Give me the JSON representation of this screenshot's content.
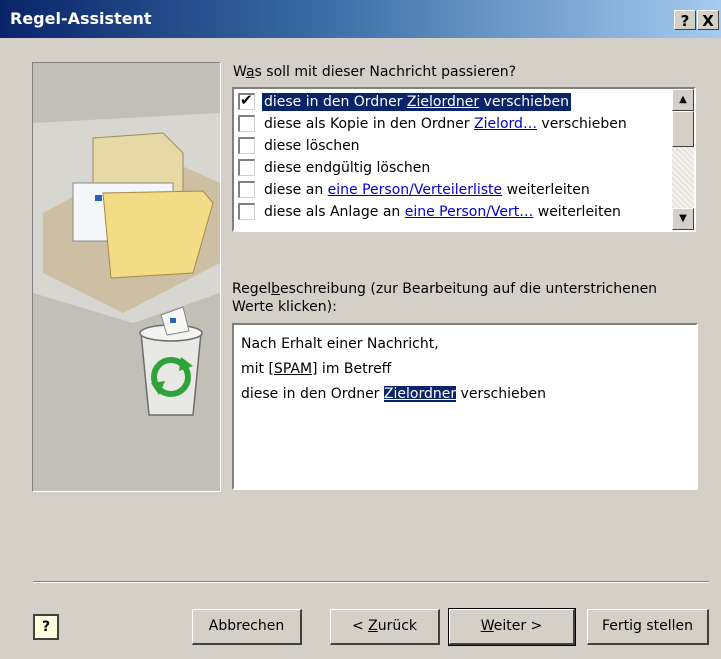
{
  "window": {
    "title": "Regel-Assistent",
    "help_btn": "?",
    "close_btn": "X"
  },
  "actions": {
    "label_prefix": "W",
    "label_u": "a",
    "label_rest": "s soll mit dieser Nachricht passieren?",
    "items": [
      {
        "checked": true,
        "pre": "diese in den Ordner ",
        "link": "Zielordner",
        "post": " verschieben"
      },
      {
        "checked": false,
        "pre": "diese als Kopie in den Ordner ",
        "link": "Zielord…",
        "post": " verschieben"
      },
      {
        "checked": false,
        "pre": "diese löschen",
        "link": "",
        "post": ""
      },
      {
        "checked": false,
        "pre": "diese endgültig löschen",
        "link": "",
        "post": ""
      },
      {
        "checked": false,
        "pre": "diese an ",
        "link": "eine Person/Verteilerliste",
        "post": " weiterleiten"
      },
      {
        "checked": false,
        "pre": "diese als Anlage an ",
        "link": "eine Person/Vert…",
        "post": " weiterleiten"
      }
    ],
    "scroll_up": "▲",
    "scroll_down": "▼"
  },
  "description": {
    "label_prefix": "Regel",
    "label_u": "b",
    "label_rest": "eschreibung (zur Bearbeitung auf die unterstrichenen",
    "label_line2": "Werte klicken):",
    "line1": "Nach Erhalt einer Nachricht,",
    "line2_pre": "mit ",
    "line2_link": "[SPAM]",
    "line2_post": " im Betreff",
    "line3_pre": "diese in den Ordner ",
    "line3_link": "Zielordner",
    "line3_post": " verschieben"
  },
  "buttons": {
    "help": "?",
    "cancel": "Abbrechen",
    "back_pre": "< ",
    "back_u": "Z",
    "back_rest": "urück",
    "next_u": "W",
    "next_rest": "eiter >",
    "finish": "Fertig stellen"
  },
  "colors": {
    "title_start": "#0a246a",
    "title_end": "#a6caf0",
    "selection": "#0a246a",
    "link": "#0000cc",
    "dialog_bg": "#d4d0c8"
  }
}
